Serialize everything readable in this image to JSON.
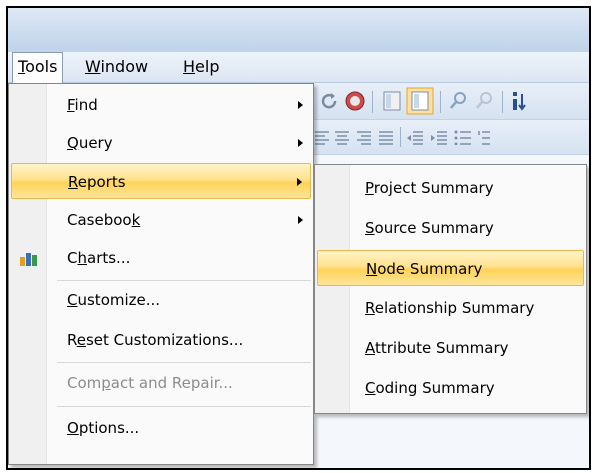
{
  "menubar": {
    "items": [
      {
        "label": "Tools",
        "accel": "T",
        "rest": "ools"
      },
      {
        "label": "Window",
        "accel": "W",
        "rest": "indow"
      },
      {
        "label": "Help",
        "accel": "H",
        "rest": "elp"
      }
    ]
  },
  "tools_menu": {
    "items": [
      {
        "pre": "",
        "accel": "F",
        "post": "ind",
        "label": "Find",
        "submenu": true
      },
      {
        "pre": "",
        "accel": "Q",
        "post": "uery",
        "label": "Query",
        "submenu": true
      },
      {
        "pre": "",
        "accel": "R",
        "post": "eports",
        "label": "Reports",
        "submenu": true,
        "highlighted": true
      },
      {
        "pre": "Caseboo",
        "accel": "k",
        "post": "",
        "label": "Casebook",
        "submenu": true
      },
      {
        "pre": "C",
        "accel": "h",
        "post": "arts...",
        "label": "Charts...",
        "icon": "charts-icon"
      },
      {
        "pre": "",
        "accel": "C",
        "post": "ustomize...",
        "label": "Customize..."
      },
      {
        "pre": "R",
        "accel": "e",
        "post": "set Customizations...",
        "label": "Reset Customizations..."
      },
      {
        "pre": "Com",
        "accel": "p",
        "post": "act and Repair...",
        "label": "Compact and Repair...",
        "disabled": true
      },
      {
        "pre": "",
        "accel": "O",
        "post": "ptions...",
        "label": "Options..."
      }
    ]
  },
  "reports_submenu": {
    "items": [
      {
        "pre": "",
        "accel": "P",
        "post": "roject Summary",
        "label": "Project Summary"
      },
      {
        "pre": "",
        "accel": "S",
        "post": "ource Summary",
        "label": "Source Summary"
      },
      {
        "pre": "",
        "accel": "N",
        "post": "ode Summary",
        "label": "Node Summary",
        "highlighted": true
      },
      {
        "pre": "",
        "accel": "R",
        "post": "elationship Summary",
        "label": "Relationship Summary"
      },
      {
        "pre": "",
        "accel": "A",
        "post": "ttribute Summary",
        "label": "Attribute Summary"
      },
      {
        "pre": "",
        "accel": "C",
        "post": "oding Summary",
        "label": "Coding Summary"
      }
    ]
  },
  "colors": {
    "highlight": "#ffd35a",
    "highlight_border": "#e8b84a",
    "disabled_text": "#8d8d8d",
    "toolbar": "#d5e2f1"
  }
}
